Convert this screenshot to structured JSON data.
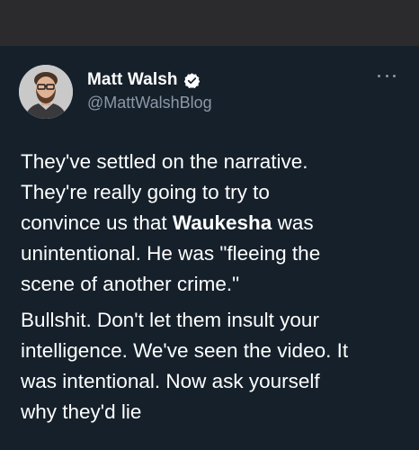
{
  "author": {
    "display_name": "Matt Walsh",
    "handle": "@MattWalshBlog",
    "verified": true,
    "verified_icon": "verified-badge-icon",
    "avatar_icon": "profile-photo"
  },
  "menu": {
    "more_icon": "more-options-icon"
  },
  "tweet": {
    "paragraph1": {
      "line1": "They've settled on the narrative.",
      "line2": "They're really going to try to",
      "line3_before": "convince us that ",
      "line3_bold": "Waukesha",
      "line3_after": " was",
      "line4": "unintentional. He was \"fleeing the",
      "line5": "scene of another crime.\""
    },
    "paragraph2": {
      "line1": "Bullshit. Don't let them insult your",
      "line2": "intelligence. We've seen the video. It",
      "line3": "was intentional. Now ask yourself",
      "line4": "why they'd lie"
    }
  },
  "colors": {
    "background": "#15202b",
    "top_bar": "#2b2b2d",
    "text": "#ffffff",
    "secondary_text": "#8b98a5"
  }
}
